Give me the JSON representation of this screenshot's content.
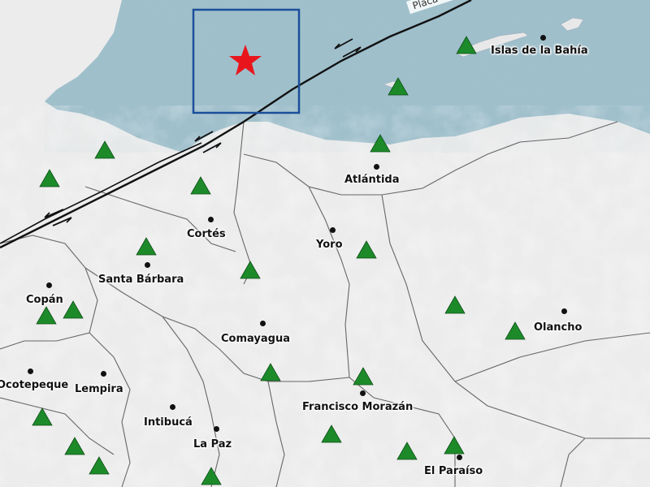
{
  "places": [
    {
      "name": "Islas de la Bahía",
      "dot": [
        668,
        46
      ],
      "label": [
        604,
        55
      ]
    },
    {
      "name": "Atlántida",
      "dot": [
        463,
        205
      ],
      "label": [
        424,
        214
      ]
    },
    {
      "name": "Cortés",
      "dot": [
        259,
        270
      ],
      "label": [
        230,
        281
      ]
    },
    {
      "name": "Yoro",
      "dot": [
        409,
        283
      ],
      "label": [
        389,
        294
      ]
    },
    {
      "name": "Santa Bárbara",
      "dot": [
        181,
        326
      ],
      "label": [
        121,
        337
      ]
    },
    {
      "name": "Copán",
      "dot": [
        60,
        351
      ],
      "label": [
        32,
        362
      ]
    },
    {
      "name": "Olancho",
      "dot": [
        694,
        383
      ],
      "label": [
        657,
        396
      ]
    },
    {
      "name": "Comayagua",
      "dot": [
        323,
        398
      ],
      "label": [
        272,
        410
      ]
    },
    {
      "name": "Ocotepeque",
      "dot": [
        37,
        457
      ],
      "label": [
        -4,
        467
      ]
    },
    {
      "name": "Lempira",
      "dot": [
        127,
        460
      ],
      "label": [
        92,
        472
      ]
    },
    {
      "name": "Francisco Morazán",
      "dot": [
        446,
        484
      ],
      "label": [
        372,
        494
      ]
    },
    {
      "name": "Intibucá",
      "dot": [
        212,
        501
      ],
      "label": [
        177,
        513
      ]
    },
    {
      "name": "La Paz",
      "dot": [
        266,
        528
      ],
      "label": [
        238,
        540
      ]
    },
    {
      "name": "El Paraíso",
      "dot": [
        565,
        563
      ],
      "label": [
        522,
        573
      ]
    }
  ],
  "fault_label": "Placa del Caribe",
  "colors": {
    "sea": "#9fbfcb",
    "land": "#ececec",
    "station": "#1d8a2a",
    "epicenter": "#e8161c",
    "box": "#1c4f9a",
    "fault": "#111111"
  }
}
